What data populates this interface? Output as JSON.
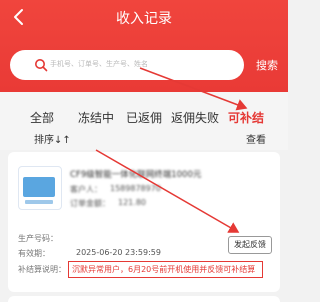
{
  "header": {
    "title": "收入记录",
    "back_icon": "chevron-left-icon",
    "search_placeholder": "手机号、订单号、生产号、姓名",
    "search_button": "搜索"
  },
  "tabs": [
    {
      "label": "全部",
      "active": false
    },
    {
      "label": "冻结中",
      "active": false
    },
    {
      "label": "已返佣",
      "active": false
    },
    {
      "label": "返佣失败",
      "active": false
    },
    {
      "label": "可补结",
      "active": true
    }
  ],
  "sort_label": "排序↓↑",
  "view_label": "查看",
  "record": {
    "product_title": "CF9级智能一体化联网终端1000元",
    "customer_label": "客户人：",
    "customer_value": "1589878970",
    "amount_label": "订单金额：",
    "amount_value": "121.80",
    "production_no_label": "生产号码：",
    "production_no_value": "",
    "valid_period_label": "有效期：",
    "valid_period_value": "2025-06-20 23:59:59",
    "note_label": "补结算说明：",
    "note_value": "沉默异常用户，6月20号前开机使用并反馈可补结算",
    "feedback_button": "发起反馈"
  },
  "colors": {
    "brand_red": "#e93a36",
    "annotation_red": "#e53935"
  }
}
